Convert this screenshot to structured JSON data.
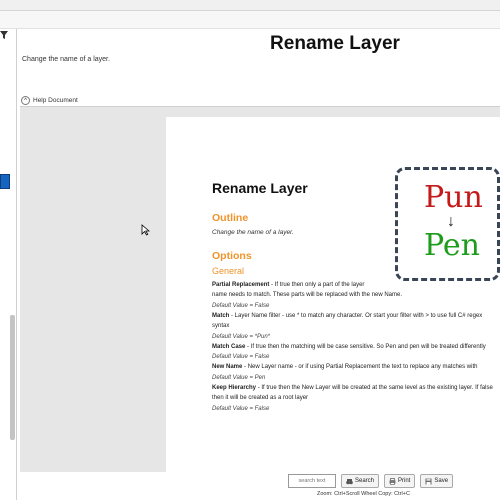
{
  "page": {
    "title": "Rename Layer",
    "subtitle": "Change the name of a layer.",
    "help_toggle_label": "Help Document",
    "help_toggle_symbol": "^"
  },
  "doc": {
    "title": "Rename Layer",
    "outline_heading": "Outline",
    "outline_text": "Change the name of a layer.",
    "options_heading": "Options",
    "general_heading": "General",
    "logo_top": "Pun",
    "logo_arrow": "↓",
    "logo_bottom": "Pen",
    "options": [
      {
        "name": "Partial Replacement",
        "text": " - If true then only a part of the layer"
      },
      {
        "text": "name needs to match. These parts will be replaced with the new Name."
      },
      {
        "default": "Default Value = False"
      },
      {
        "name": "Match",
        "text": " - Layer Name filter - use * to match any character. Or start your filter with > to use full C# regex"
      },
      {
        "text": "syntax"
      },
      {
        "default": "Default Value = *Pun*"
      },
      {
        "name": "Match Case",
        "text": " - If true then the matching will be case sensitive. So Pen and pen will be treated differently"
      },
      {
        "default": "Default Value = False"
      },
      {
        "name": "New Name",
        "text": " - New Layer name - or if using Partial Replacement  the text to replace any matches with"
      },
      {
        "default": "Default Value = Pen"
      },
      {
        "name": "Keep Hierarchy",
        "text": " - If true then the New Layer will be created at the same level as the existing layer. If false"
      },
      {
        "text": "then it will be created as a root layer"
      },
      {
        "default": "Default Value = False"
      }
    ]
  },
  "toolbar": {
    "search_placeholder": "search text",
    "search_label": "Search",
    "print_label": "Print",
    "save_label": "Save",
    "zoom_hint": "Zoom: Ctrl+Scroll Wheel  Copy: Ctrl+C"
  },
  "colors": {
    "accent_orange": "#f0932b",
    "logo_red": "#c41a1a",
    "logo_green": "#1e9c1e",
    "selection_blue": "#1565c0"
  }
}
